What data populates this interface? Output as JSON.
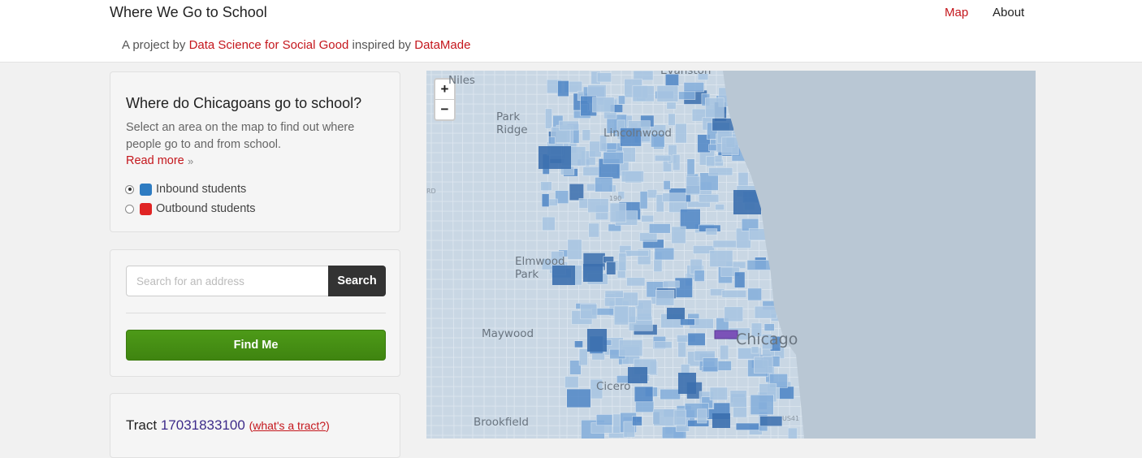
{
  "header": {
    "brand": "Where We Go to School",
    "nav": {
      "map": "Map",
      "about": "About"
    },
    "tagline": {
      "prefix": "A project by",
      "org1": "Data Science for Social Good",
      "middle": "inspired by",
      "org2": "DataMade"
    }
  },
  "intro": {
    "title": "Where do Chicagoans go to school?",
    "description": "Select an area on the map to find out where people go to and from school.",
    "read_more": "Read more",
    "read_more_suffix": "»",
    "options": [
      {
        "label": "Inbound students",
        "selected": true,
        "color": "#2e7cc2"
      },
      {
        "label": "Outbound students",
        "selected": false,
        "color": "#e02424"
      }
    ]
  },
  "search": {
    "placeholder": "Search for an address",
    "value": "",
    "button": "Search",
    "find_me": "Find Me"
  },
  "tract": {
    "label": "Tract",
    "id": "17031833100",
    "help_open": "(",
    "help": "what's a tract?",
    "help_close": ")"
  },
  "map": {
    "zoom_in": "+",
    "zoom_out": "−",
    "places": {
      "evanston": "Evanston",
      "niles": "Niles",
      "park_ridge": "Park Ridge",
      "lincolnwood": "Lincolnwood",
      "elmwood_park": "Elmwood Park",
      "maywood": "Maywood",
      "cicero": "Cicero",
      "brookfield": "Brookfield",
      "chicago": "Chicago"
    },
    "road_labels": {
      "i190": "190",
      "ord": "RD",
      "us41": "US41"
    },
    "colors": {
      "water": "#b9c7d4",
      "land": "#c9d7e4",
      "tract_light": "#a8c5e2",
      "tract_mid": "#84aedb",
      "tract_dark": "#4f86c6",
      "tract_darkest": "#3b6fae",
      "selected_tract": "#7b52b8"
    }
  }
}
